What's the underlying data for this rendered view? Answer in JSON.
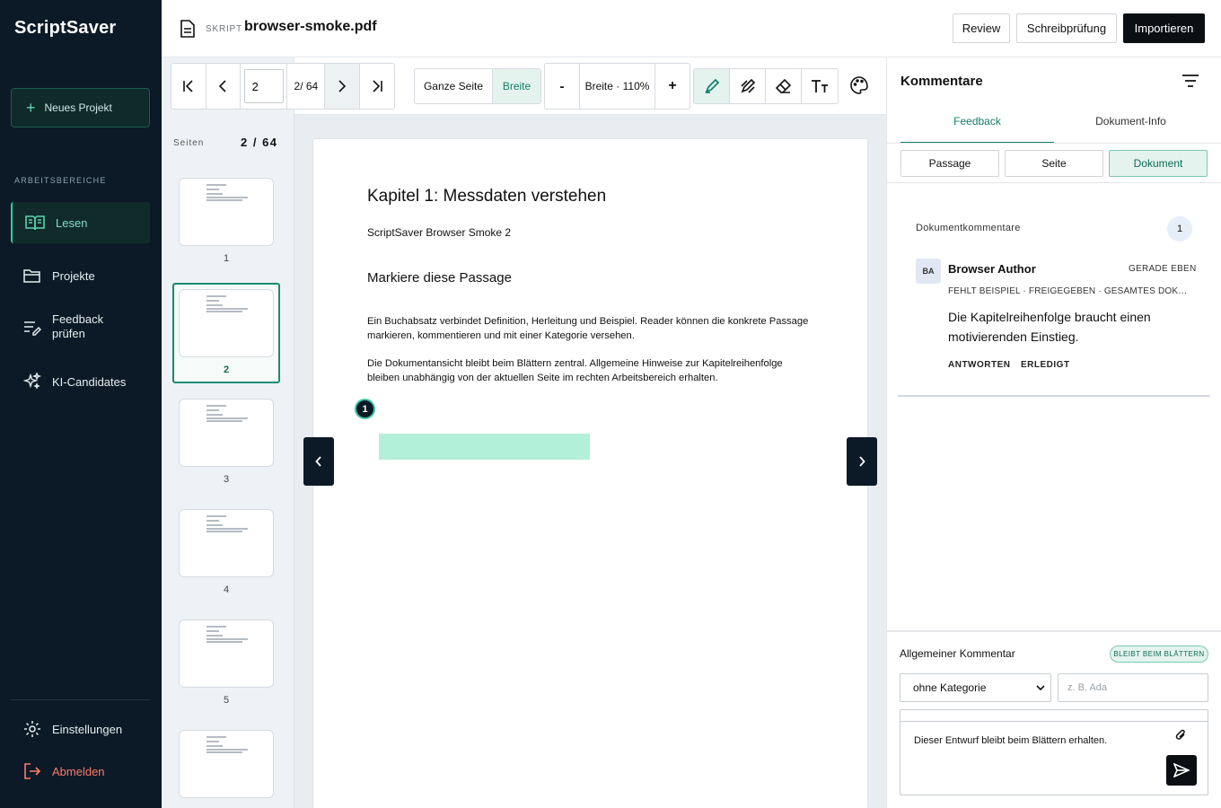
{
  "brand": "ScriptSaver",
  "sidebar": {
    "new_project": "Neues Projekt",
    "section_label": "ARBEITSBEREICHE",
    "items": [
      {
        "label": "Lesen",
        "icon": "book-open-icon"
      },
      {
        "label": "Projekte",
        "icon": "folder-icon"
      },
      {
        "label": "Feedback prüfen",
        "icon": "review-list-icon"
      },
      {
        "label": "KI-Candidates",
        "icon": "sparkle-icon"
      }
    ],
    "settings": "Einstellungen",
    "logout": "Abmelden"
  },
  "header": {
    "kind": "SKRIPT",
    "title": "browser-smoke.pdf",
    "review": "Review",
    "spellcheck": "Schreibprüfung",
    "import": "Importieren"
  },
  "toolbar": {
    "page_input": "2",
    "page_total": "2/ 64",
    "fit_page": "Ganze Seite",
    "fit_width": "Breite",
    "zoom_out": "-",
    "zoom_label": "Breite · 110%",
    "zoom_in": "+"
  },
  "thumbnails": {
    "label": "Seiten",
    "counter": "2 / 64",
    "pages": [
      "1",
      "2",
      "3",
      "4",
      "5"
    ]
  },
  "document": {
    "heading": "Kapitel 1: Messdaten verstehen",
    "subtitle": "ScriptSaver Browser Smoke 2",
    "section": "Markiere diese Passage",
    "paragraph1": "Ein Buchabsatz verbindet Definition, Herleitung und Beispiel. Reader können die konkrete Passage markieren, kommentieren und mit einer Kategorie versehen.",
    "paragraph2": "Die Dokumentansicht bleibt beim Blättern zentral. Allgemeine Hinweise zur Kapitelreihenfolge bleiben unabhängig von der aktuellen Seite im rechten Arbeitsbereich erhalten.",
    "marker_number": "1"
  },
  "panel": {
    "title": "Kommentare",
    "tabs": [
      "Feedback",
      "Dokument-Info"
    ],
    "scope": [
      "Passage",
      "Seite",
      "Dokument"
    ],
    "doc_comments_label": "Dokumentkommentare",
    "doc_comments_count": "1",
    "comment": {
      "initials": "BA",
      "author": "Browser Author",
      "time": "GERADE EBEN",
      "meta": "FEHLT BEISPIEL · FREIGEGEBEN · GESAMTES DOKUMENT",
      "body": "Die Kapitelreihenfolge braucht einen motivierenden Einstieg.",
      "reply": "ANTWORTEN",
      "done": "ERLEDIGT"
    },
    "composer": {
      "label": "Allgemeiner Kommentar",
      "badge": "BLEIBT BEIM BLÄTTERN",
      "category": "ohne Kategorie",
      "name_placeholder": "z. B. Ada",
      "draft": "Dieser Entwurf bleibt beim Blättern erhalten."
    }
  },
  "colors": {
    "sidebar_bg": "#0b1a26",
    "accent": "#12806a",
    "highlight": "#b3f0d9"
  }
}
